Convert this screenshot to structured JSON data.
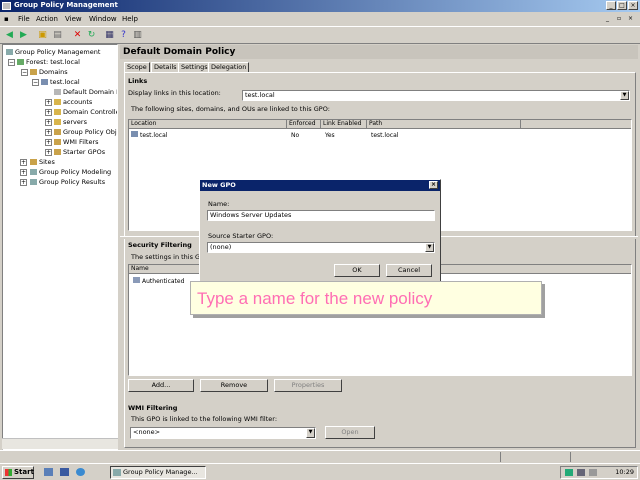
{
  "window": {
    "title": "Group Policy Management"
  },
  "menu": [
    "File",
    "Action",
    "View",
    "Window",
    "Help"
  ],
  "toolbar": {
    "icons": [
      "back-icon",
      "forward-icon",
      "folder-up-icon",
      "properties-icon",
      "refresh-icon",
      "delete-icon",
      "refresh-icon",
      "export-icon",
      "help-icon",
      "console-icon"
    ]
  },
  "tree": {
    "items": [
      {
        "label": "Group Policy Management"
      },
      {
        "label": "Forest: test.local"
      },
      {
        "label": "Domains"
      },
      {
        "label": "test.local"
      },
      {
        "label": "Default Domain P"
      },
      {
        "label": "accounts"
      },
      {
        "label": "Domain Controlle"
      },
      {
        "label": "servers"
      },
      {
        "label": "Group Policy Obje"
      },
      {
        "label": "WMI Filters"
      },
      {
        "label": "Starter GPOs"
      },
      {
        "label": "Sites"
      },
      {
        "label": "Group Policy Modeling"
      },
      {
        "label": "Group Policy Results"
      }
    ]
  },
  "right": {
    "title": "Default Domain Policy",
    "tabs": [
      "Scope",
      "Details",
      "Settings",
      "Delegation"
    ],
    "links": {
      "heading": "Links",
      "display_label": "Display links in this location:",
      "display_value": "test.local",
      "description": "The following sites, domains, and OUs are linked to this GPO:",
      "columns": [
        "Location",
        "Enforced",
        "Link Enabled",
        "Path"
      ],
      "rows": [
        {
          "location": "test.local",
          "enforced": "No",
          "link_enabled": "Yes",
          "path": "test.local"
        }
      ]
    },
    "security": {
      "heading": "Security Filtering",
      "description": "The settings in this GPO",
      "columns": [
        "Name"
      ],
      "rows": [
        {
          "name": "Authenticated"
        }
      ],
      "buttons": [
        "Add...",
        "Remove",
        "Properties"
      ]
    },
    "wmi": {
      "heading": "WMI Filtering",
      "description": "This GPO is linked to the following WMI filter:",
      "value": "<none>",
      "open_button": "Open"
    }
  },
  "dialog": {
    "title": "New GPO",
    "name_label": "Name:",
    "name_value": "Windows Server Updates",
    "source_label": "Source Starter GPO:",
    "source_value": "(none)",
    "ok": "OK",
    "cancel": "Cancel"
  },
  "callout": {
    "text": "Type a name for the new policy",
    "color": "#ff6eb4"
  },
  "taskbar": {
    "start": "Start",
    "task": "Group Policy Manage...",
    "clock": "10:29"
  }
}
